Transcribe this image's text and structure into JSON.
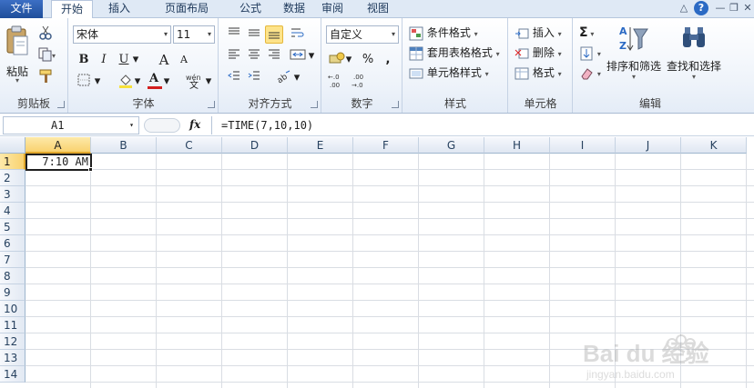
{
  "tabs": {
    "file": "文件",
    "home": "开始",
    "insert": "插入",
    "page_layout": "页面布局",
    "formulas": "公式",
    "data": "数据",
    "review": "审阅",
    "view": "视图"
  },
  "clipboard": {
    "paste": "粘贴",
    "group": "剪贴板"
  },
  "font": {
    "name": "宋体",
    "size": "11",
    "bold": "B",
    "italic": "I",
    "underline": "U",
    "grow": "A",
    "shrink": "A",
    "group": "字体"
  },
  "alignment": {
    "group": "对齐方式"
  },
  "number": {
    "format": "自定义",
    "percent": "%",
    "comma": ",",
    "inc_decimal": ".0\n.00",
    "group": "数字"
  },
  "styles": {
    "conditional": "条件格式",
    "table": "套用表格格式",
    "cell": "单元格样式",
    "group": "样式"
  },
  "cells": {
    "insert": "插入",
    "delete": "删除",
    "format": "格式",
    "group": "单元格"
  },
  "editing": {
    "sort": "排序和筛选",
    "find": "查找和选择",
    "group": "编辑"
  },
  "formula_bar": {
    "name_box": "A1",
    "fx": "fx",
    "formula": "=TIME(7,10,10)"
  },
  "sheet": {
    "columns": [
      "A",
      "B",
      "C",
      "D",
      "E",
      "F",
      "G",
      "H",
      "I",
      "J",
      "K"
    ],
    "rows": [
      "1",
      "2",
      "3",
      "4",
      "5",
      "6",
      "7",
      "8",
      "9",
      "10",
      "11",
      "12",
      "13",
      "14"
    ],
    "selected_column": "A",
    "selected_row": "1",
    "a1_value": "7:10 AM"
  },
  "watermark": {
    "brand": "Bai du 经验",
    "url": "jingyan.baidu.com"
  },
  "colors": {
    "file_tab": "#2b579a",
    "highlight": "#fde38a",
    "font_color": "#d21f1f",
    "fill_color": "#f7e13a"
  }
}
